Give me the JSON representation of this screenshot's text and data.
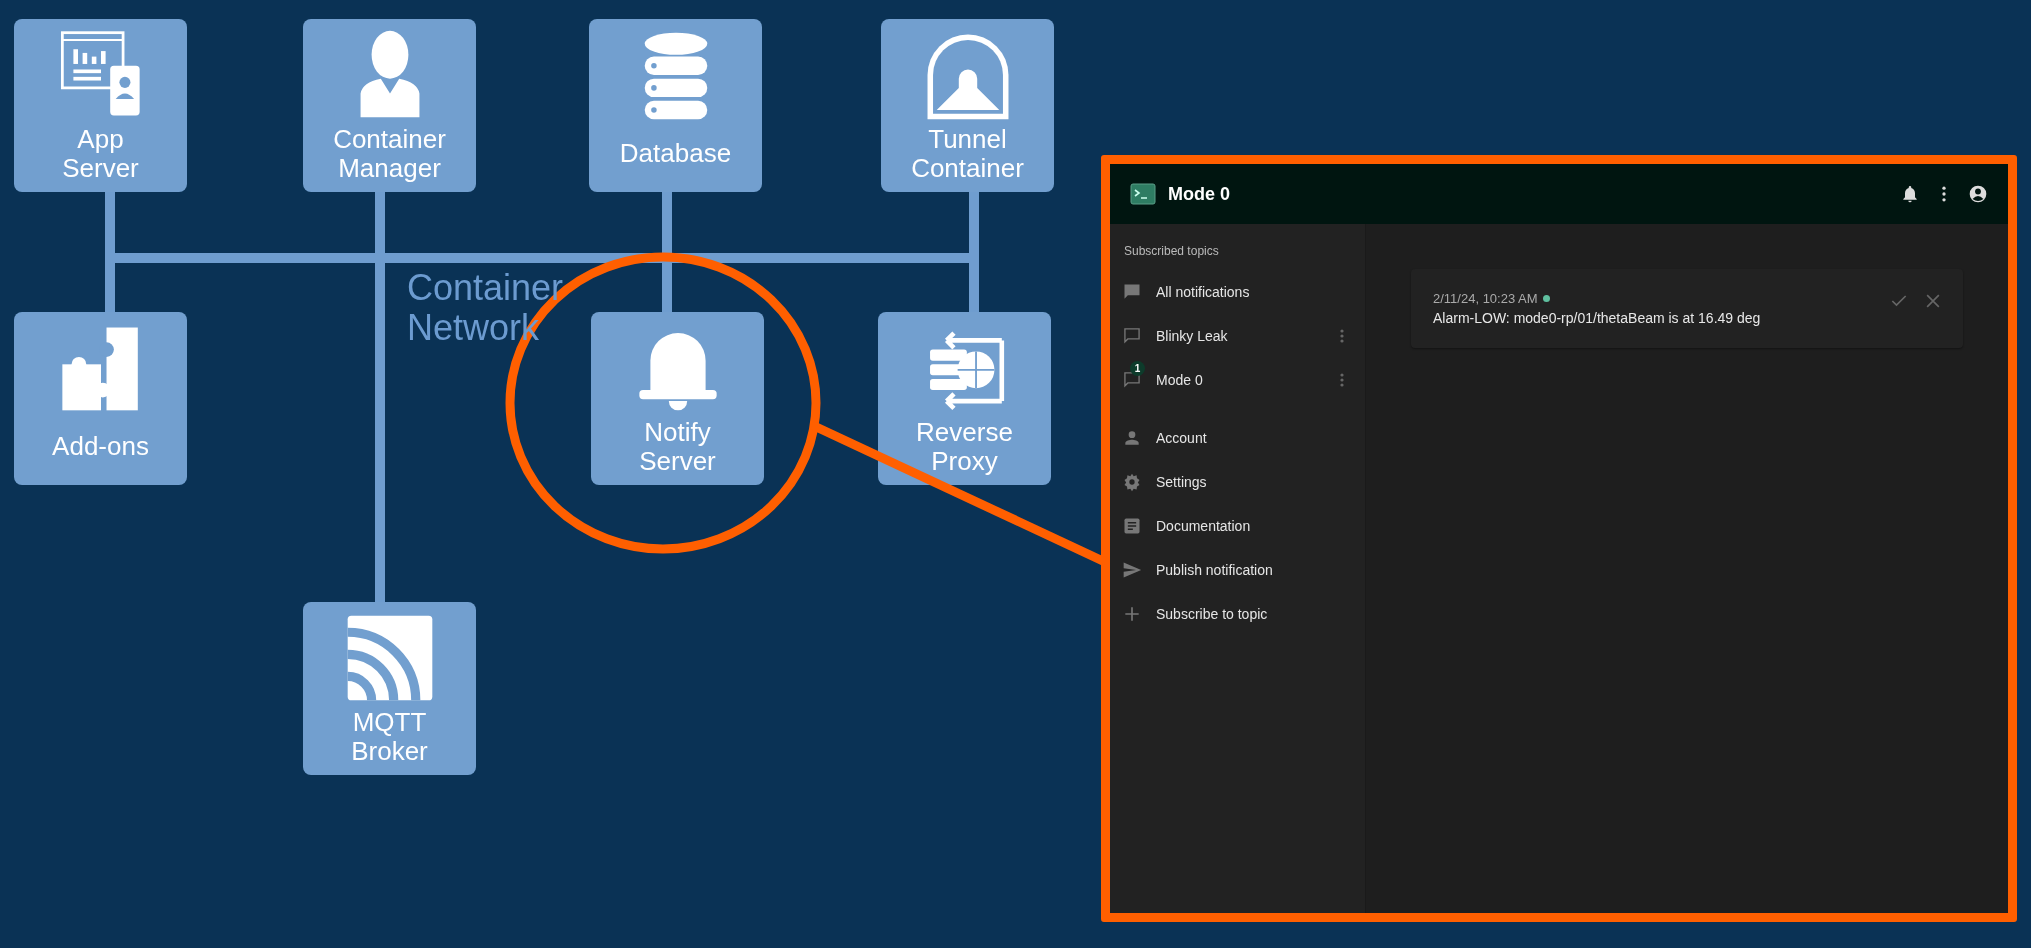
{
  "diagram": {
    "network_label": "Container Network",
    "nodes": [
      {
        "label": "App\nServer",
        "kind": "app"
      },
      {
        "label": "Container\nManager",
        "kind": "manager"
      },
      {
        "label": "Database",
        "kind": "database"
      },
      {
        "label": "Tunnel\nContainer",
        "kind": "tunnel"
      },
      {
        "label": "Add-ons",
        "kind": "addons"
      },
      {
        "label": "Notify\nServer",
        "kind": "notify"
      },
      {
        "label": "Reverse\nProxy",
        "kind": "proxy"
      },
      {
        "label": "MQTT\nBroker",
        "kind": "mqtt"
      }
    ]
  },
  "app": {
    "title": "Mode 0",
    "sidebar": {
      "heading": "Subscribed topics",
      "topics": [
        {
          "label": "All notifications",
          "kind": "all"
        },
        {
          "label": "Blinky Leak",
          "kind": "topic"
        },
        {
          "label": "Mode 0",
          "kind": "topic",
          "badge": "1"
        }
      ],
      "items": [
        {
          "label": "Account",
          "kind": "account"
        },
        {
          "label": "Settings",
          "kind": "settings"
        },
        {
          "label": "Documentation",
          "kind": "docs"
        },
        {
          "label": "Publish notification",
          "kind": "publish"
        },
        {
          "label": "Subscribe to topic",
          "kind": "subscribe"
        }
      ]
    },
    "notifications": [
      {
        "time": "2/11/24, 10:23 AM",
        "new": true,
        "message": "Alarm-LOW: mode0-rp/01/thetaBeam is at 16.49 deg"
      }
    ]
  }
}
